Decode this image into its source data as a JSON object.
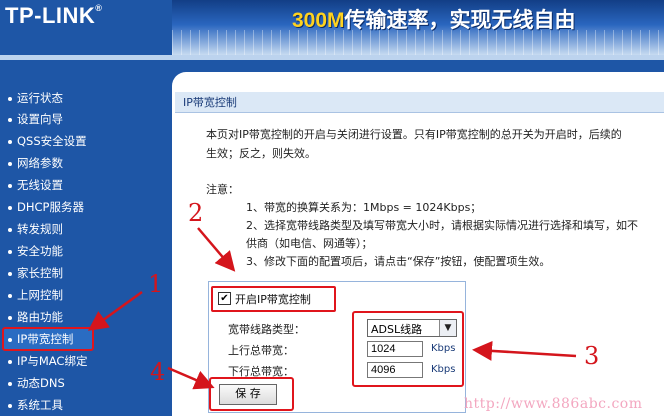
{
  "header": {
    "logo": "TP-LINK",
    "logo_mark": "®",
    "banner_prefix": "300M",
    "banner_rest": "传输速率，实现无线自由"
  },
  "sidebar": {
    "items": [
      {
        "label": "运行状态"
      },
      {
        "label": "设置向导"
      },
      {
        "label": "QSS安全设置"
      },
      {
        "label": "网络参数"
      },
      {
        "label": "无线设置"
      },
      {
        "label": "DHCP服务器"
      },
      {
        "label": "转发规则"
      },
      {
        "label": "安全功能"
      },
      {
        "label": "家长控制"
      },
      {
        "label": "上网控制"
      },
      {
        "label": "路由功能"
      },
      {
        "label": "IP带宽控制",
        "active": true
      },
      {
        "label": "IP与MAC绑定"
      },
      {
        "label": "动态DNS"
      },
      {
        "label": "系统工具"
      }
    ]
  },
  "panel": {
    "title": "IP带宽控制",
    "intro_line1": "本页对IP带宽控制的开启与关闭进行设置。只有IP带宽控制的总开关为开启时，后续的",
    "intro_line2": "生效；反之，则失效。",
    "notes_title": "注意：",
    "note1": "1、带宽的换算关系为：1Mbps = 1024Kbps；",
    "note2a": "2、选择宽带线路类型及填写带宽大小时，请根据实际情况进行选择和填写，如不",
    "note2b": "供商（如电信、网通等）；",
    "note3": "3、修改下面的配置项后，请点击“保存”按钮，使配置项生效。"
  },
  "form": {
    "enable_checked": true,
    "check_glyph": "✔",
    "enable_label": "开启IP带宽控制",
    "line_type_label": "宽带线路类型：",
    "line_type_value": "ADSL线路",
    "up_label": "上行总带宽：",
    "up_value": "1024",
    "down_label": "下行总带宽：",
    "down_value": "4096",
    "unit": "Kbps",
    "save_label": "保 存",
    "dropdown_glyph": "▼"
  },
  "annotations": {
    "a1": "1",
    "a2": "2",
    "a3": "3",
    "a4": "4"
  },
  "watermark": "http://www.886abc.com",
  "colors": {
    "brand_blue": "#1e56a6",
    "annotation_red": "#e0151c"
  }
}
